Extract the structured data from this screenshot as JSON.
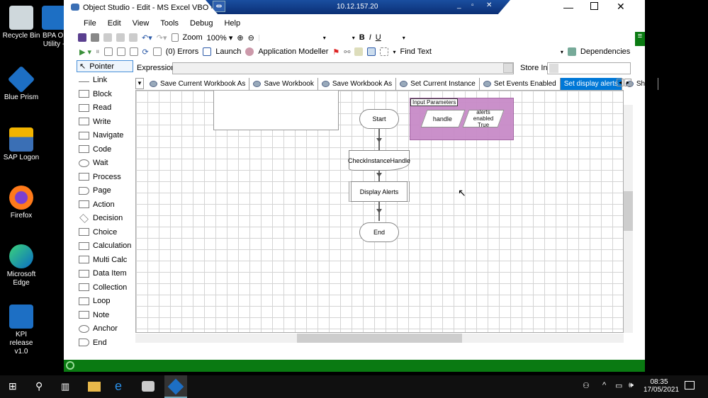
{
  "desktop": {
    "icons": [
      {
        "label": "Recycle Bin"
      },
      {
        "label": "BPA OI Utility -"
      },
      {
        "label": "Blue Prism"
      },
      {
        "label": "SAP Logon"
      },
      {
        "label": "Firefox"
      },
      {
        "label": "Microsoft Edge"
      },
      {
        "label": "KPI release v1.0"
      }
    ]
  },
  "window": {
    "title": "Object Studio  - Edit - MS Excel VBO - L",
    "rdp_host": "10.12.157.20"
  },
  "menu": [
    "File",
    "Edit",
    "View",
    "Tools",
    "Debug",
    "Help"
  ],
  "toolbar1": {
    "zoom_label": "Zoom",
    "zoom_value": "100%",
    "bold": "B",
    "italic": "I",
    "underline": "U"
  },
  "toolbar2": {
    "errors": "(0) Errors",
    "launch": "Launch",
    "app_modeller": "Application Modeller",
    "find_text": "Find Text",
    "dependencies": "Dependencies"
  },
  "palette": [
    "Pointer",
    "Link",
    "Block",
    "Read",
    "Write",
    "Navigate",
    "Code",
    "Wait",
    "Process",
    "Page",
    "Action",
    "Decision",
    "Choice",
    "Calculation",
    "Multi Calc",
    "Data Item",
    "Collection",
    "Loop",
    "Note",
    "Anchor",
    "End"
  ],
  "expression": {
    "label": "Expression:",
    "value": "",
    "store_in_label": "Store In:",
    "store_in_value": ""
  },
  "tabs": [
    {
      "label": "Save Current Workbook As"
    },
    {
      "label": "Save Workbook"
    },
    {
      "label": "Save Workbook As"
    },
    {
      "label": "Set Current Instance"
    },
    {
      "label": "Set Events Enabled"
    },
    {
      "label": "Set display alerts",
      "active": true
    },
    {
      "label": "Show"
    }
  ],
  "diagram": {
    "start": "Start",
    "check": "CheckInstanceHandle",
    "action": "Display Alerts",
    "end": "End",
    "input_params_title": "Input Parameters",
    "params": [
      "handle",
      "alerts enabled\nTrue"
    ]
  },
  "taskbar": {
    "time": "08:35",
    "date": "17/05/2021"
  },
  "colors": {
    "accent": "#0078d7",
    "green": "#0a7a12",
    "param_bg": "#c88bc8"
  }
}
